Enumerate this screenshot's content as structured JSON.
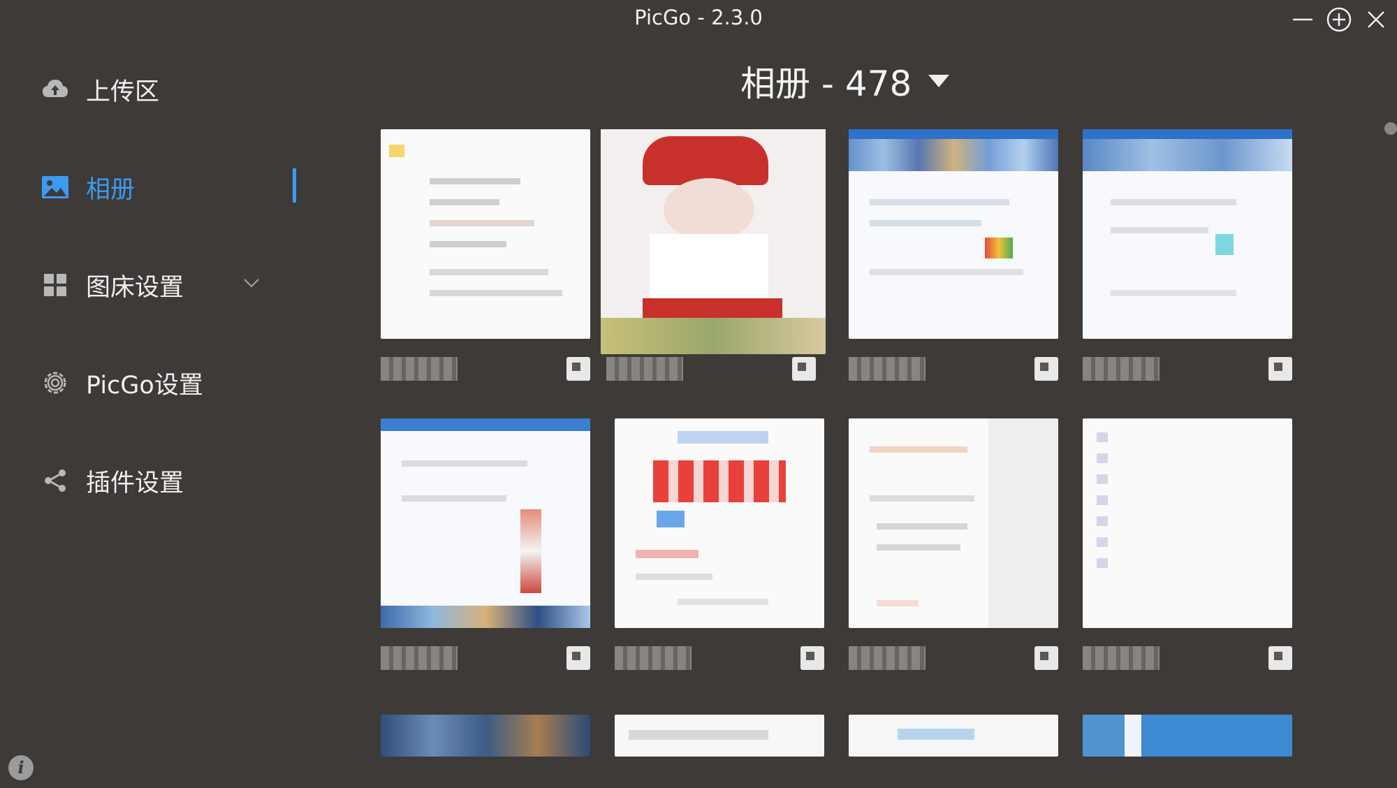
{
  "window": {
    "title": "PicGo - 2.3.0"
  },
  "sidebar": {
    "items": [
      {
        "label": "上传区",
        "icon": "cloud-upload-icon"
      },
      {
        "label": "相册",
        "icon": "image-icon",
        "active": true
      },
      {
        "label": "图床设置",
        "icon": "grid-icon",
        "expandable": true
      },
      {
        "label": "PicGo设置",
        "icon": "gear-icon"
      },
      {
        "label": "插件设置",
        "icon": "share-icon"
      }
    ],
    "info_icon": "i"
  },
  "gallery": {
    "heading": "相册 - 478",
    "dropdown_icon": "caret-down-icon"
  },
  "colors": {
    "accent": "#3d9af2",
    "background": "#3d3a37"
  }
}
